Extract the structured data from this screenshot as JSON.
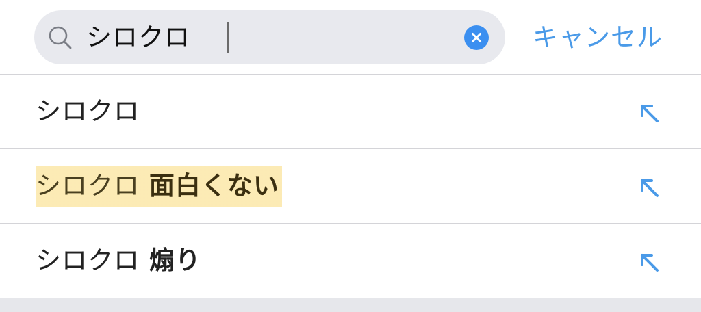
{
  "search": {
    "query": "シロクロ",
    "cancel_label": "キャンセル"
  },
  "suggestions": [
    {
      "query_part": "シロクロ",
      "suffix": ""
    },
    {
      "query_part": "シロクロ",
      "suffix": " 面白くない"
    },
    {
      "query_part": "シロクロ",
      "suffix": " 煽り"
    }
  ],
  "colors": {
    "accent": "#3b8ff0",
    "cancel_text": "#4a9ae8",
    "search_bg": "#e8e9ee",
    "highlight": "#fada78"
  }
}
